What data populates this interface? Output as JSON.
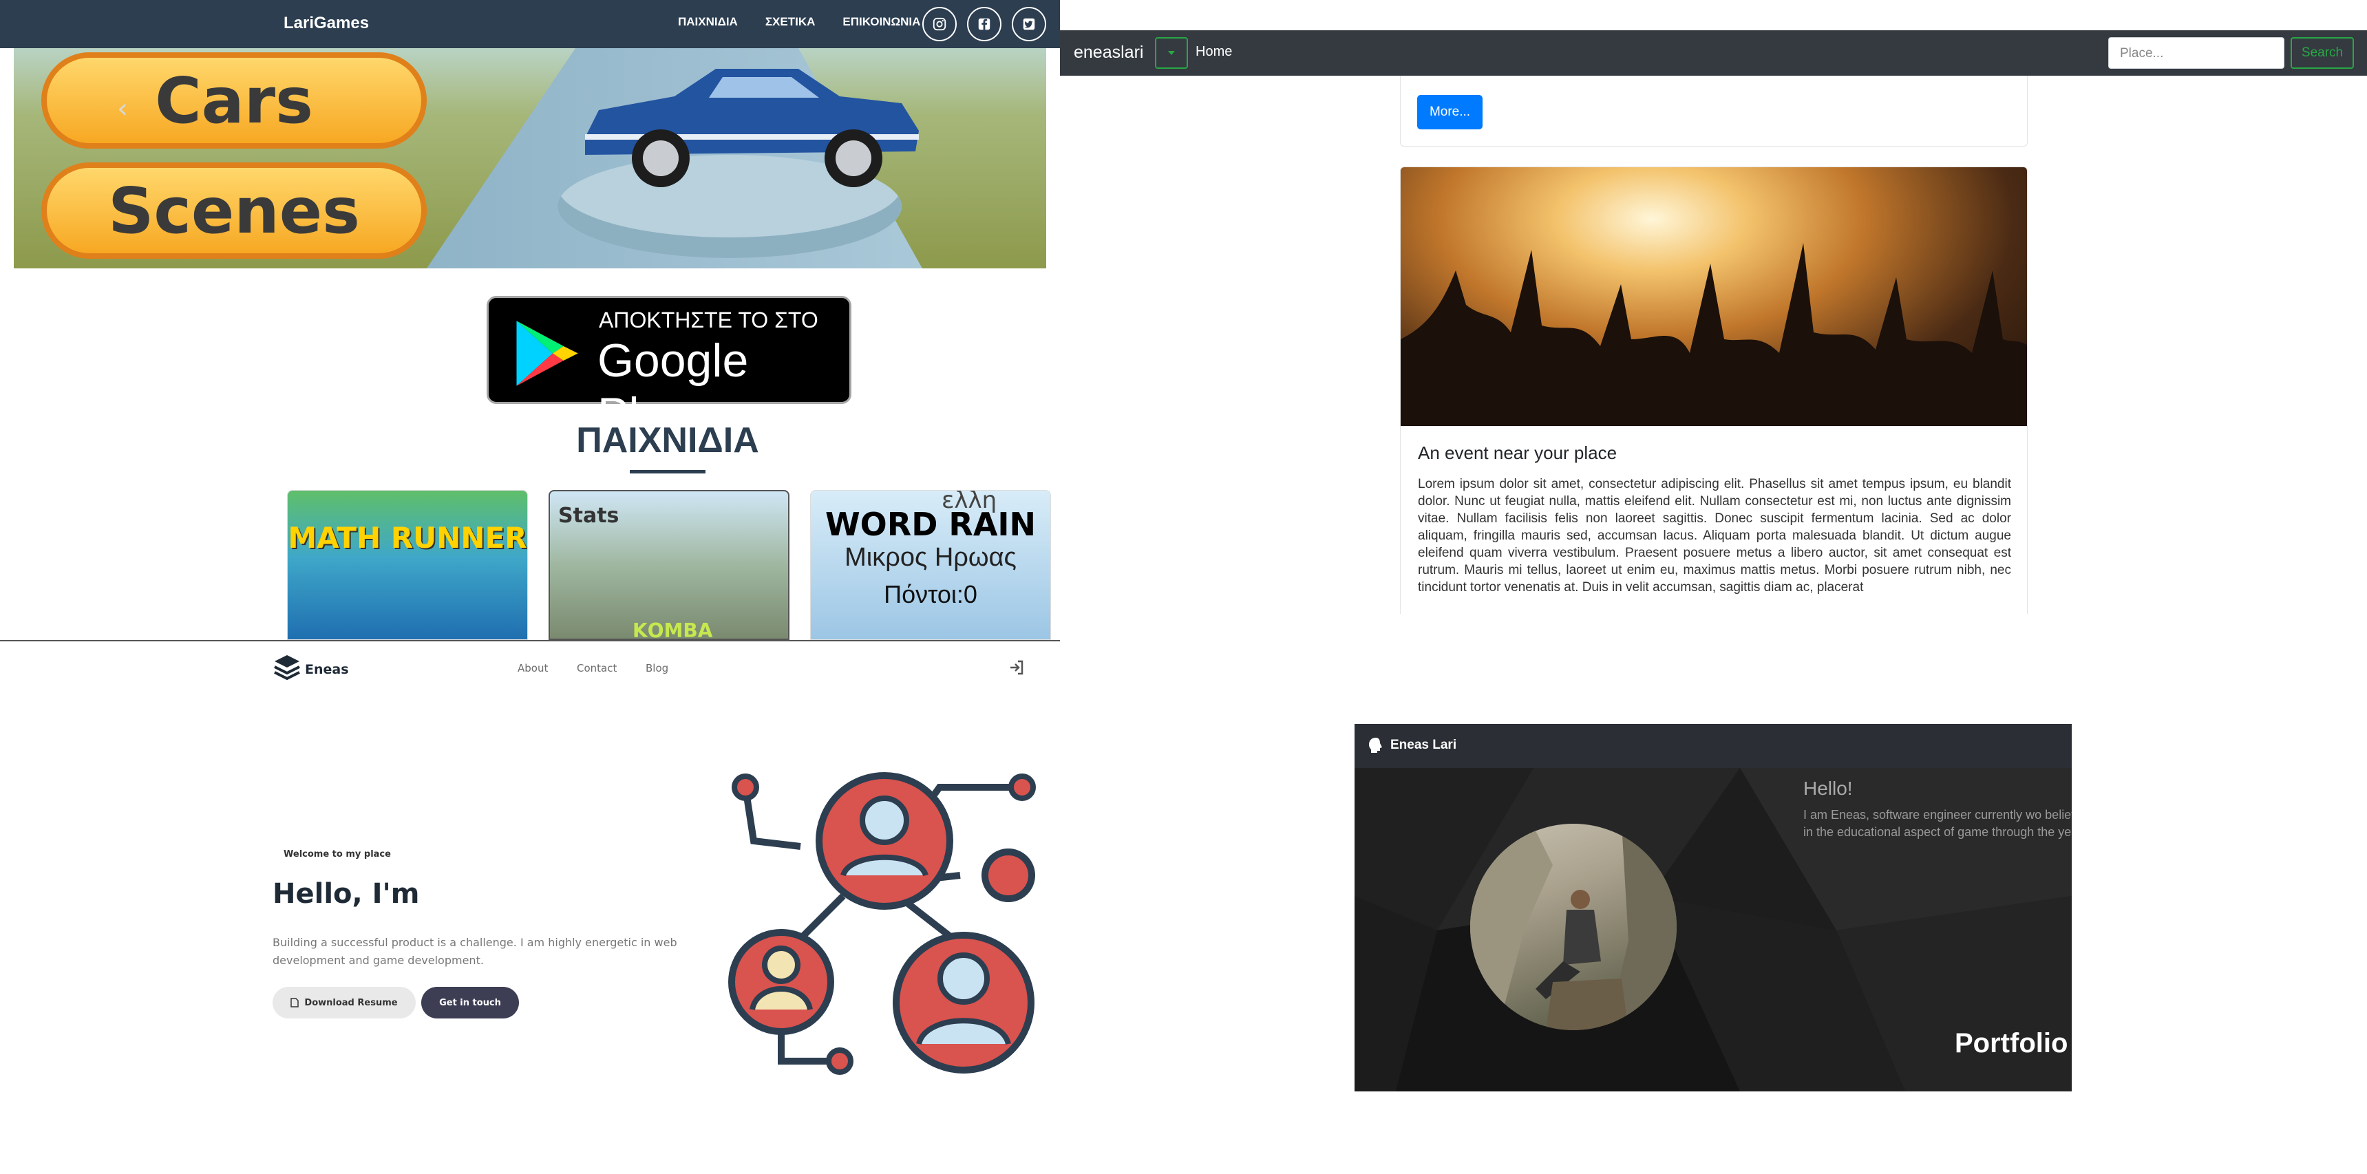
{
  "larigames": {
    "brand": "LariGames",
    "nav": [
      "ΠΑΙΧΝΙΔΙΑ",
      "ΣΧΕΤΙΚΑ",
      "ΕΠΙΚΟΙΝΩΝΙΑ"
    ],
    "social_icons": [
      "instagram-icon",
      "facebook-icon",
      "twitter-icon"
    ],
    "hero_buttons": [
      "Cars",
      "Scenes"
    ],
    "google_play": {
      "sub": "ΑΠΟΚΤΗΣΤΕ ΤΟ ΣΤΟ",
      "main": "Google Play"
    },
    "section_title": "ΠΑΙΧΝΙΔΙΑ",
    "games": [
      {
        "title": "MATH RUNNER"
      },
      {
        "title": "Stats",
        "extra": "ΚΟΜΒΑ"
      },
      {
        "title": "WORD RAIN",
        "line2": "Μικρος Ηρωας",
        "line3": "Πόντοι:0",
        "overlay": "ελλη"
      }
    ]
  },
  "events": {
    "brand": "eneaslari",
    "home": "Home",
    "search_placeholder": "Place...",
    "search_button": "Search",
    "more_button": "More...",
    "card_title": "An event near your place",
    "card_text": "Lorem ipsum dolor sit amet, consectetur adipiscing elit. Phasellus sit amet tempus ipsum, eu blandit dolor. Nunc ut feugiat nulla, mattis eleifend elit. Nullam consectetur est mi, non luctus ante dignissim vitae. Nullam facilisis felis non laoreet sagittis. Donec suscipit fermentum lacinia. Sed ac dolor aliquam, fringilla mauris sed, accumsan lacus. Aliquam porta malesuada blandit. Ut dictum augue eleifend quam viverra vestibulum. Praesent posuere metus a libero auctor, sit amet consequat est rutrum. Mauris mi tellus, laoreet ut enim eu, maximus mattis metus. Morbi posuere rutrum nibh, nec tincidunt tortor venenatis at. Duis in velit accumsan, sagittis diam ac, placerat"
  },
  "portfolio": {
    "brand": "Eneas",
    "nav": [
      "About",
      "Contact",
      "Blog"
    ],
    "welcome": "Welcome to my place",
    "headline": "Hello, I'm",
    "description": "Building a successful product is a challenge. I am highly energetic in web development and game development.",
    "btn_resume": "Download Resume",
    "btn_contact": "Get in touch"
  },
  "dark": {
    "brand": "Eneas Lari",
    "hello": "Hello!",
    "text": "I am Eneas, software engineer currently wo believes in the educational aspect of game through the years.",
    "portfolio": "Portfolio"
  },
  "colors": {
    "navy": "#2c3e50",
    "green": "#28a745",
    "blue": "#007bff",
    "coral": "#d9534f",
    "dark": "#343a40"
  }
}
